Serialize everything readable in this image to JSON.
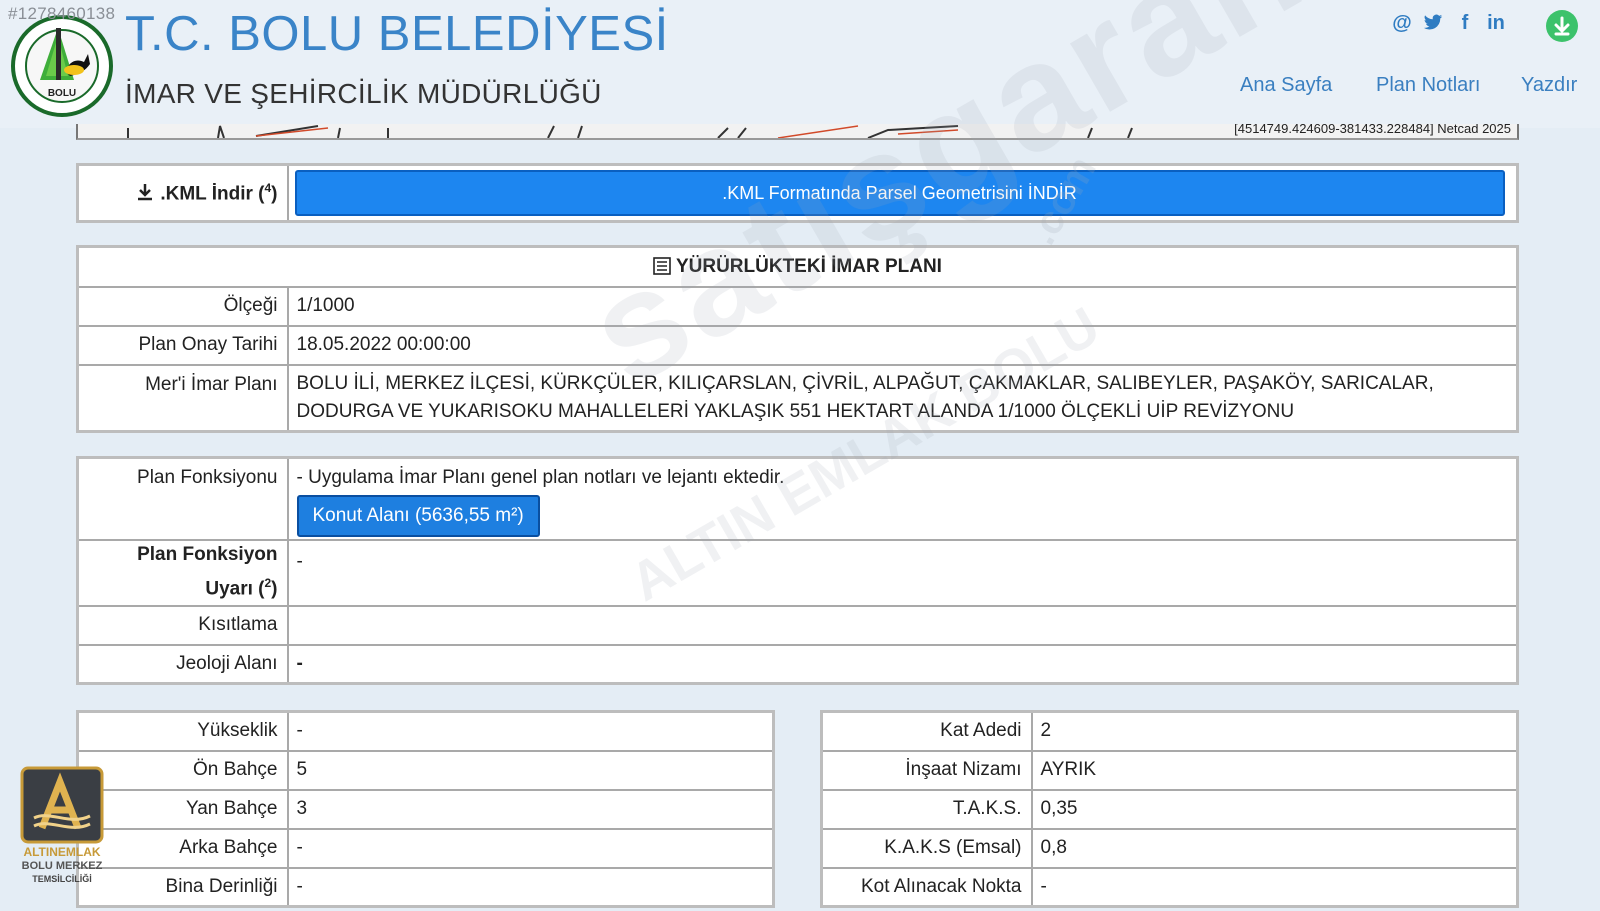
{
  "listing_id": "#1278460138",
  "header": {
    "title": "T.C. BOLU BELEDİYESİ",
    "subtitle": "İMAR VE ŞEHİRCİLİK MÜDÜRLÜĞÜ",
    "nav": [
      "Ana Sayfa",
      "Plan Notları",
      "Yazdır"
    ],
    "social": [
      "@",
      "twitter-icon",
      "f",
      "in"
    ],
    "logo_text_top": "BOLU",
    "logo_text_ring": "BELEDİYE BAŞKANLIĞI"
  },
  "map_strip": {
    "coords": "[4514749.424609-381433.228484] Netcad 2025"
  },
  "kml": {
    "label": ".KML İndir (",
    "sup": "4",
    "label_end": ")",
    "button": ".KML Formatında Parsel Geometrisini İNDİR"
  },
  "plan": {
    "header": "YÜRÜRLÜKTEKİ İMAR PLANI",
    "rows": [
      {
        "label": "Ölçeği",
        "value": "1/1000"
      },
      {
        "label": "Plan Onay Tarihi",
        "value": "18.05.2022 00:00:00"
      },
      {
        "label": "Mer'i İmar Planı",
        "value": "BOLU İLİ, MERKEZ İLÇESİ, KÜRKÇÜLER, KILIÇARSLAN, ÇİVRİL, ALPAĞUT, ÇAKMAKLAR, SALIBEYLER, PAŞAKÖY, SARICALAR, DODURGA VE YUKARISOKU MAHALLELERİ YAKLAŞIK 551 HEKTART ALANDA 1/1000 ÖLÇEKLİ UİP REVİZYONU"
      }
    ]
  },
  "function": {
    "label": "Plan Fonksiyonu",
    "note": "- Uygulama İmar Planı genel plan notları ve lejantı ektedir.",
    "button": "Konut Alanı (5636,55 m²)",
    "warn_label_1": "Plan Fonksiyon",
    "warn_label_2": "Uyarı (",
    "warn_sup": "2",
    "warn_label_end": ")",
    "warn_value": "-",
    "restriction_label": "Kısıtlama",
    "restriction_value": "",
    "geology_label": "Jeoloji Alanı",
    "geology_value": "-"
  },
  "left_table": [
    {
      "label": "Yükseklik",
      "value": "-"
    },
    {
      "label": "Ön Bahçe",
      "value": "5"
    },
    {
      "label": "Yan Bahçe",
      "value": "3"
    },
    {
      "label": "Arka Bahçe",
      "value": "-"
    },
    {
      "label": "Bina Derinliği",
      "value": "-"
    }
  ],
  "right_table": [
    {
      "label": "Kat Adedi",
      "value": "2"
    },
    {
      "label": "İnşaat Nizamı",
      "value": "AYRIK"
    },
    {
      "label": "T.A.K.S.",
      "value": "0,35"
    },
    {
      "label": "K.A.K.S (Emsal)",
      "value": "0,8"
    },
    {
      "label": "Kot Alınacak Nokta",
      "value": "-"
    }
  ],
  "watermark": {
    "main": "satışgaranti",
    "sub": "ALTIN EMLAK BOLU",
    "domain": ".com"
  },
  "badge": {
    "brand": "ALTINEMLAK",
    "line1": "BOLU MERKEZ",
    "line2": "TEMSİLCİLİĞİ"
  },
  "colors": {
    "accent": "#1d86f0",
    "title": "#3a84c8",
    "warning": "#c84a00",
    "download": "#3cc26b"
  }
}
